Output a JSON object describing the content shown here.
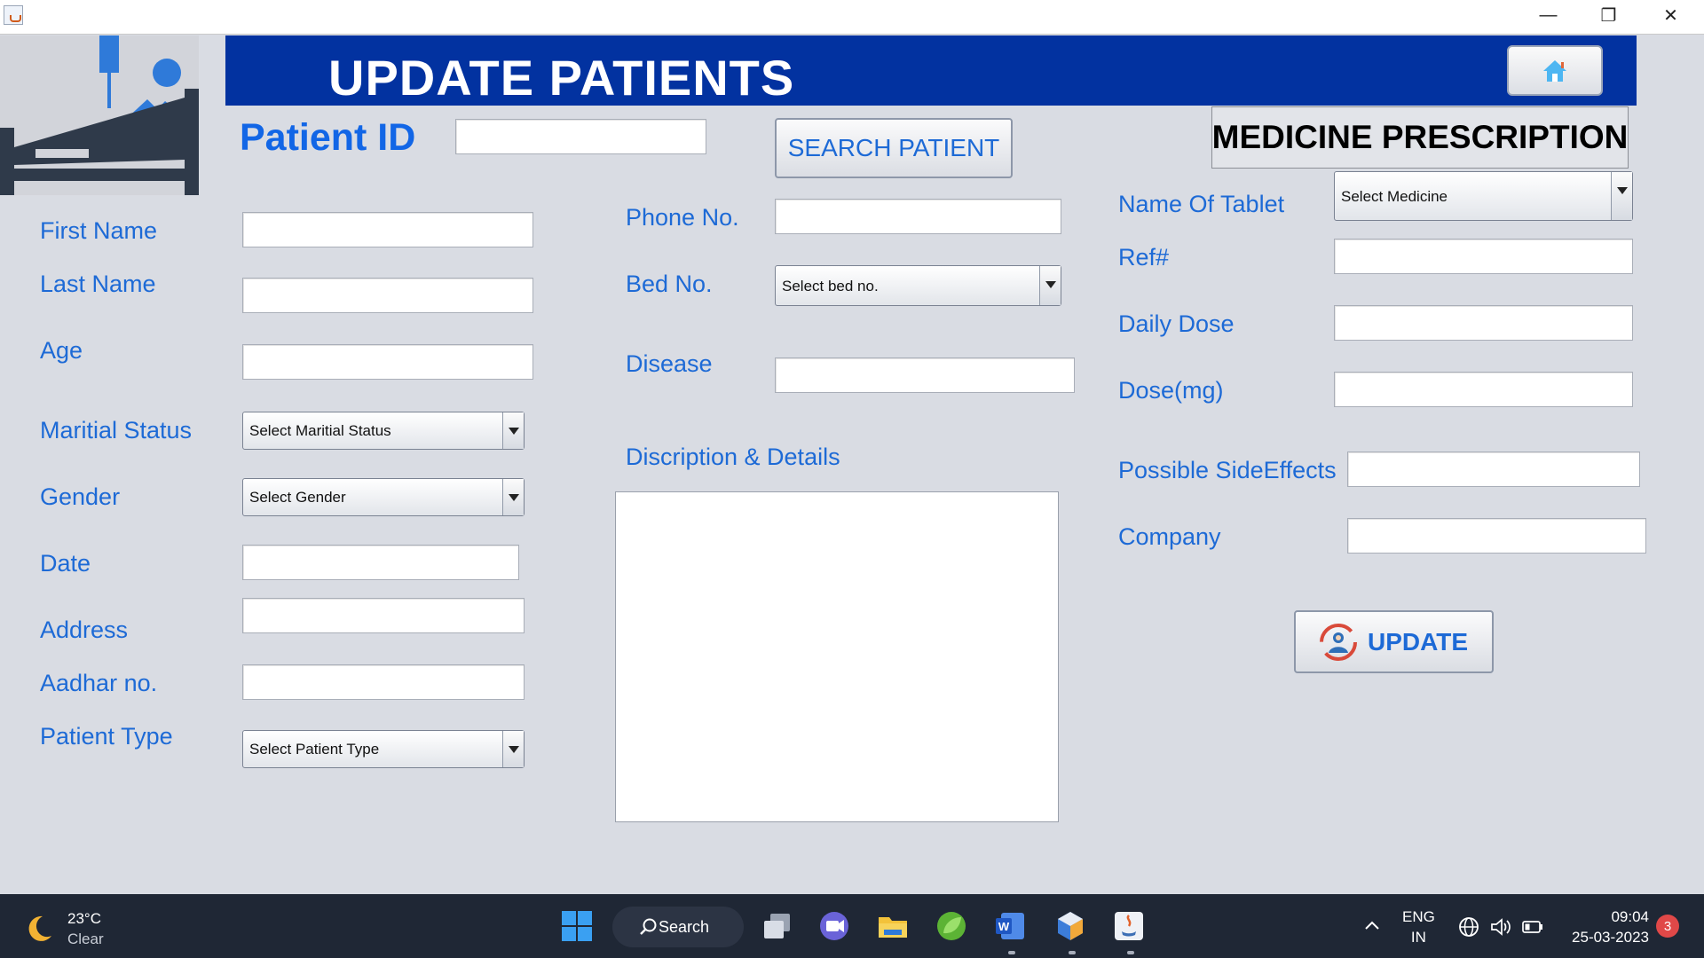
{
  "window": {
    "minimize_glyph": "—",
    "maximize_glyph": "❐",
    "close_glyph": "✕"
  },
  "header": {
    "title": "UPDATE PATIENTS",
    "home_icon": "home-icon"
  },
  "search": {
    "patient_id_label": "Patient ID",
    "patient_id_value": "",
    "search_button_label": "SEARCH PATIENT"
  },
  "patient_form": {
    "first_name_label": "First Name",
    "last_name_label": "Last Name",
    "age_label": "Age",
    "marital_status_label": "Maritial Status",
    "marital_status_selected": "Select Maritial Status",
    "gender_label": "Gender",
    "gender_selected": "Select Gender",
    "date_label": "Date",
    "address_label": "Address",
    "aadhar_label": "Aadhar no.",
    "patient_type_label": "Patient Type",
    "patient_type_selected": "Select Patient Type",
    "phone_label": "Phone No.",
    "bed_label": "Bed No.",
    "bed_selected": "Select bed no.",
    "disease_label": "Disease",
    "description_label": "Discription & Details"
  },
  "prescription": {
    "title": "MEDICINE PRESCRIPTION",
    "tablet_label": "Name Of Tablet",
    "tablet_selected": "Select Medicine",
    "ref_label": "Ref#",
    "daily_dose_label": "Daily Dose",
    "dose_mg_label": "Dose(mg)",
    "side_effects_label": "Possible SideEffects",
    "company_label": "Company",
    "update_button_label": "UPDATE"
  },
  "taskbar": {
    "temperature": "23°C",
    "condition": "Clear",
    "search_label": "Search",
    "lang_top": "ENG",
    "lang_bottom": "IN",
    "time": "09:04",
    "date": "25-03-2023",
    "notification_count": "3"
  },
  "colors": {
    "header_blue": "#0232a0",
    "label_blue": "#1d6ad6",
    "taskbar": "#1f2735"
  }
}
